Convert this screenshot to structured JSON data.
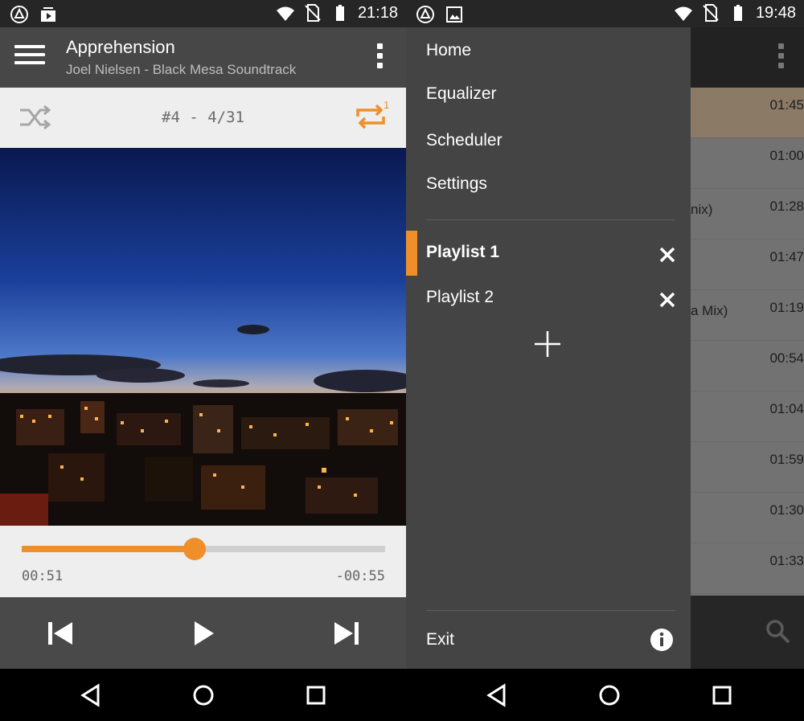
{
  "left": {
    "status": {
      "time": "21:18"
    },
    "header": {
      "title": "Apprehension",
      "subtitle": "Joel Nielsen - Black Mesa Soundtrack"
    },
    "mode": {
      "counter": "#4 - 4/31",
      "repeat_badge": "1"
    },
    "seek": {
      "elapsed": "00:51",
      "remaining": "-00:55",
      "progress": 0.476
    },
    "colors": {
      "accent": "#ee8f2a"
    }
  },
  "right": {
    "status": {
      "time": "19:48"
    },
    "drawer": {
      "menu": [
        {
          "label": "Home"
        },
        {
          "label": "Equalizer"
        },
        {
          "label": "Scheduler"
        },
        {
          "label": "Settings"
        }
      ],
      "playlists": [
        {
          "label": "Playlist 1",
          "active": true
        },
        {
          "label": "Playlist 2",
          "active": false
        }
      ],
      "exit_label": "Exit"
    },
    "background_list": {
      "rows": [
        {
          "time": "01:45",
          "extra": "",
          "active": true
        },
        {
          "time": "01:00",
          "extra": ""
        },
        {
          "time": "01:28",
          "extra": "nix)"
        },
        {
          "time": "01:47",
          "extra": ""
        },
        {
          "time": "01:19",
          "extra": "a Mix)"
        },
        {
          "time": "00:54",
          "extra": ""
        },
        {
          "time": "01:04",
          "extra": ""
        },
        {
          "time": "01:59",
          "extra": ""
        },
        {
          "time": "01:30",
          "extra": ""
        },
        {
          "time": "01:33",
          "extra": ""
        }
      ]
    }
  },
  "icons": {
    "status_left": [
      "signal-triangle-icon",
      "media-icon",
      "image-icon"
    ],
    "status_right": [
      "wifi-icon",
      "no-sim-icon",
      "battery-icon"
    ],
    "nav": [
      "back-icon",
      "home-icon",
      "recents-icon"
    ]
  }
}
